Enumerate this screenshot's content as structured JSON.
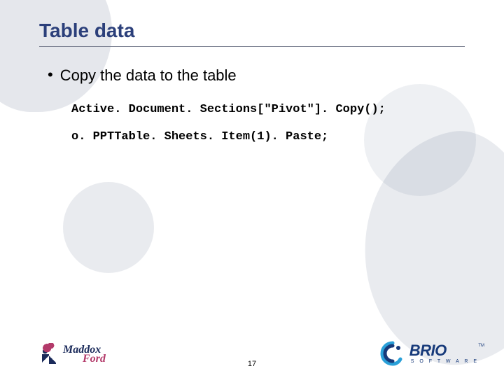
{
  "title": "Table data",
  "bullet": "Copy the data to the table",
  "code": {
    "line1": "Active. Document. Sections[\"Pivot\"]. Copy();",
    "line2": "o. PPTTable. Sheets. Item(1). Paste;"
  },
  "page_number": "17",
  "logos": {
    "left": {
      "line1": "Maddox",
      "line2": "Ford"
    },
    "right": {
      "brand": "BRIO",
      "sub": "S O F T W A R E",
      "tm": "TM"
    }
  }
}
